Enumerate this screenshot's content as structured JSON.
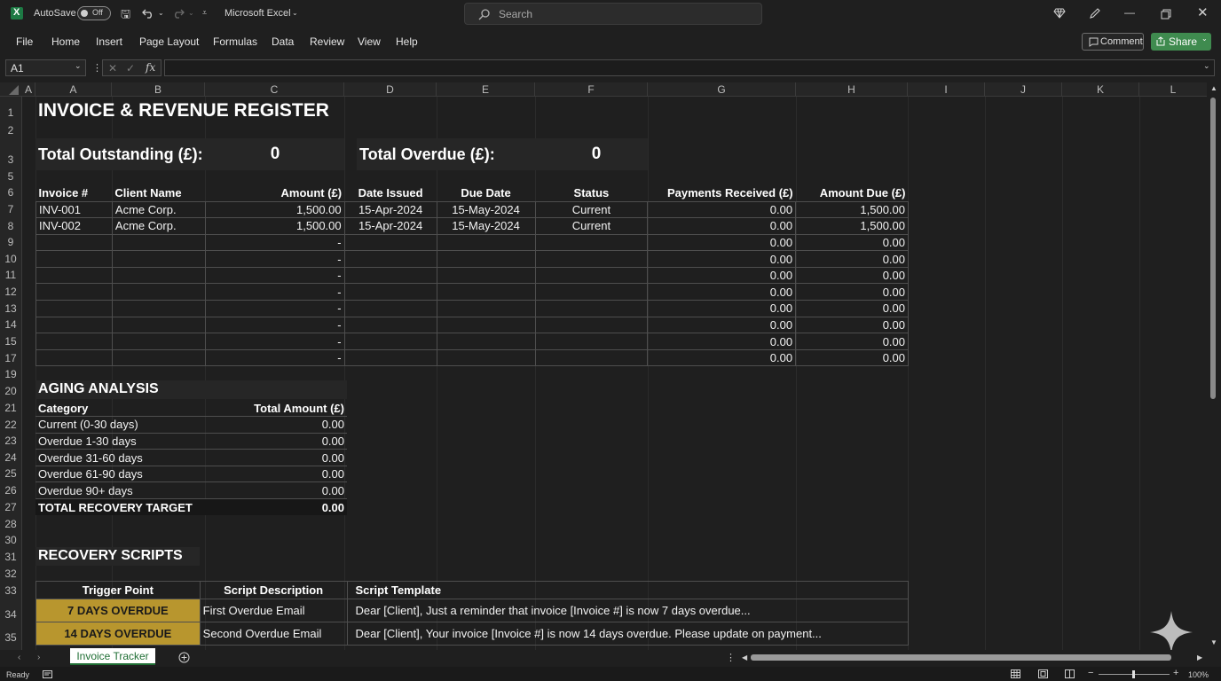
{
  "titlebar": {
    "autosave_label": "AutoSave",
    "autosave_state": "Off",
    "app_title": "Microsoft Excel",
    "search_placeholder": "Search"
  },
  "menu": {
    "items": [
      "File",
      "Home",
      "Insert",
      "Page Layout",
      "Formulas",
      "Data",
      "Review",
      "View",
      "Help"
    ],
    "comment_label": "Comment",
    "share_label": "Share"
  },
  "formula_bar": {
    "name_box": "A1",
    "fx_label": "fx",
    "formula": ""
  },
  "columns": [
    "A",
    "A",
    "B",
    "C",
    "D",
    "E",
    "F",
    "G",
    "H",
    "I",
    "J",
    "K",
    "L"
  ],
  "rows": [
    "1",
    "2",
    "3",
    "5",
    "6",
    "7",
    "8",
    "9",
    "10",
    "11",
    "12",
    "13",
    "14",
    "15",
    "17",
    "19",
    "20",
    "21",
    "22",
    "23",
    "24",
    "25",
    "26",
    "27",
    "28",
    "30",
    "31",
    "32",
    "33",
    "34",
    "35"
  ],
  "sheet": {
    "title": "INVOICE & REVENUE REGISTER",
    "kpi_outstanding_label": "Total Outstanding (£):",
    "kpi_outstanding_value": "0",
    "kpi_overdue_label": "Total Overdue (£):",
    "kpi_overdue_value": "0",
    "invoice_headers": [
      "Invoice #",
      "Client Name",
      "Amount (£)",
      "Date Issued",
      "Due Date",
      "Status",
      "Payments Received (£)",
      "Amount Due (£)"
    ],
    "invoice_rows": [
      [
        "INV-001",
        "Acme Corp.",
        "1,500.00",
        "15-Apr-2024",
        "15-May-2024",
        "Current",
        "0.00",
        "1,500.00"
      ],
      [
        "INV-002",
        "Acme Corp.",
        "1,500.00",
        "15-Apr-2024",
        "15-May-2024",
        "Current",
        "0.00",
        "1,500.00"
      ],
      [
        "",
        "",
        "-",
        "",
        "",
        "",
        "0.00",
        "0.00"
      ],
      [
        "",
        "",
        "-",
        "",
        "",
        "",
        "0.00",
        "0.00"
      ],
      [
        "",
        "",
        "-",
        "",
        "",
        "",
        "0.00",
        "0.00"
      ],
      [
        "",
        "",
        "-",
        "",
        "",
        "",
        "0.00",
        "0.00"
      ],
      [
        "",
        "",
        "-",
        "",
        "",
        "",
        "0.00",
        "0.00"
      ],
      [
        "",
        "",
        "-",
        "",
        "",
        "",
        "0.00",
        "0.00"
      ],
      [
        "",
        "",
        "-",
        "",
        "",
        "",
        "0.00",
        "0.00"
      ],
      [
        "",
        "",
        "-",
        "",
        "",
        "",
        "0.00",
        "0.00"
      ]
    ],
    "aging_title": "AGING ANALYSIS",
    "aging_headers": [
      "Category",
      "Total Amount (£)"
    ],
    "aging_rows": [
      [
        "Current (0-30 days)",
        "0.00"
      ],
      [
        "Overdue 1-30 days",
        "0.00"
      ],
      [
        "Overdue 31-60 days",
        "0.00"
      ],
      [
        "Overdue 61-90 days",
        "0.00"
      ],
      [
        "Overdue 90+ days",
        "0.00"
      ]
    ],
    "aging_total": [
      "TOTAL RECOVERY TARGET",
      "0.00"
    ],
    "recovery_title": "RECOVERY SCRIPTS",
    "recovery_headers": [
      "Trigger Point",
      "Script Description",
      "Script Template"
    ],
    "recovery_rows": [
      [
        "7 DAYS OVERDUE",
        "First Overdue Email",
        "Dear [Client], Just a reminder that invoice [Invoice #] is now 7 days overdue..."
      ],
      [
        "14 DAYS OVERDUE",
        "Second Overdue Email",
        "Dear [Client], Your invoice [Invoice #] is now 14 days overdue. Please update on payment..."
      ]
    ]
  },
  "tabs": {
    "active": "Invoice Tracker"
  },
  "status": {
    "ready": "Ready",
    "zoom": "100%"
  },
  "colors": {
    "trigger_fill": "#b8962e",
    "share_green": "#3f8b4f",
    "background": "#1f1f1f"
  }
}
